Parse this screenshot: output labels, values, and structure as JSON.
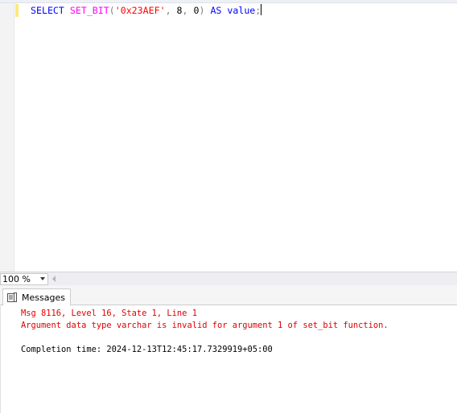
{
  "editor": {
    "tokens": {
      "select_kw": "SELECT",
      "space1": " ",
      "fn_name": "SET_BIT",
      "open_paren": "(",
      "str_arg": "'0x23AEF'",
      "comma1": ",",
      "space2": " ",
      "arg2": "8",
      "comma2": ",",
      "space3": " ",
      "arg3": "0",
      "close_paren": ")",
      "space4": " ",
      "as_kw": "AS",
      "space5": " ",
      "alias": "value",
      "semicolon": ";"
    }
  },
  "zoom": {
    "value": "100 %"
  },
  "results": {
    "tab_label": "Messages",
    "messages": {
      "error_header": "Msg 8116, Level 16, State 1, Line 1",
      "error_text": "Argument data type varchar is invalid for argument 1 of set_bit function.",
      "blank": "",
      "completion": "Completion time: 2024-12-13T12:45:17.7329919+05:00"
    }
  },
  "colors": {
    "keyword": "#0000ff",
    "function": "#ff00ff",
    "string": "#ff0000",
    "error": "#e00000",
    "change_marker": "#ffe97a"
  },
  "icons": {
    "messages_tab_icon": "messages-document-icon",
    "zoom_dropdown": "chevron-down-icon",
    "scroll_left": "scroll-left-arrow-icon"
  }
}
